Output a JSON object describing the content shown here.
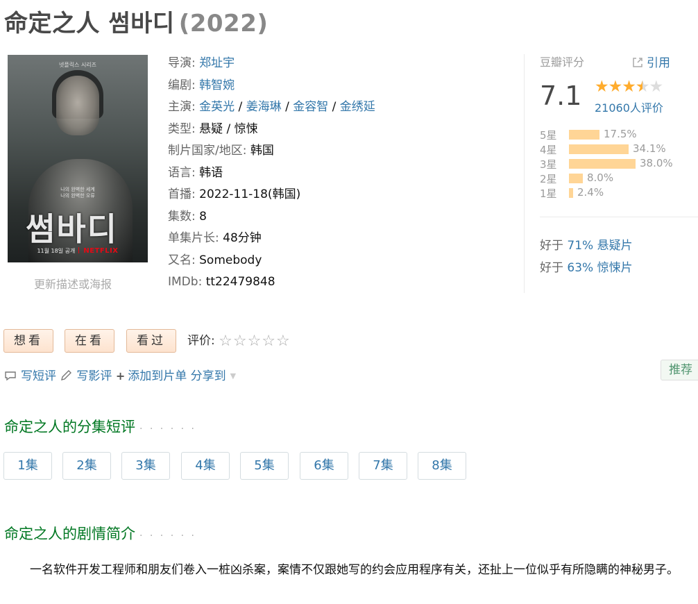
{
  "title": {
    "name": "命定之人 썸바디",
    "year": "(2022)"
  },
  "poster": {
    "topline": "넷플릭스 시리즈",
    "tagline_1": "나의 완벽한 세계",
    "tagline_2": "나의 완벽한 오류",
    "hangul": "썸바디",
    "release_line": "11월 18일 공개",
    "brand": "NETFLIX"
  },
  "update_link": "更新描述或海报",
  "info": {
    "director": {
      "label": "导演: ",
      "names": [
        "郑址宇"
      ]
    },
    "writer": {
      "label": "编剧: ",
      "names": [
        "韩智婉"
      ]
    },
    "cast": {
      "label": "主演: ",
      "names": [
        "金英光",
        "姜海琳",
        "金容智",
        "金绣延"
      ],
      "sep": " / "
    },
    "genre": {
      "label": "类型: ",
      "value": "悬疑 / 惊悚"
    },
    "country": {
      "label": "制片国家/地区: ",
      "value": "韩国"
    },
    "language": {
      "label": "语言: ",
      "value": "韩语"
    },
    "premiere": {
      "label": "首播: ",
      "value": "2022-11-18(韩国)"
    },
    "episodes": {
      "label": "集数: ",
      "value": "8"
    },
    "runtime": {
      "label": "单集片长: ",
      "value": "48分钟"
    },
    "aka": {
      "label": "又名: ",
      "value": "Somebody"
    },
    "imdb": {
      "label": "IMDb: ",
      "value": "tt22479848"
    }
  },
  "rating": {
    "header": "豆瓣评分",
    "cite": "引用",
    "score": "7.1",
    "stars_value": 3.5,
    "votes": "21060人评价",
    "distribution": [
      {
        "label": "5星",
        "percent": "17.5%",
        "value": 17.5
      },
      {
        "label": "4星",
        "percent": "34.1%",
        "value": 34.1
      },
      {
        "label": "3星",
        "percent": "38.0%",
        "value": 38.0
      },
      {
        "label": "2星",
        "percent": "8.0%",
        "value": 8.0
      },
      {
        "label": "1星",
        "percent": "2.4%",
        "value": 2.4
      }
    ],
    "better_than": [
      {
        "prefix": "好于 ",
        "pct": "71%",
        "genre": "悬疑片"
      },
      {
        "prefix": "好于 ",
        "pct": "63%",
        "genre": "惊悚片"
      }
    ]
  },
  "buttons": {
    "want": "想看",
    "watching": "在看",
    "watched": "看过"
  },
  "my_rating": {
    "label": "评价: ",
    "stars": "☆☆☆☆☆"
  },
  "actions": {
    "short_review": "写短评",
    "review": "写影评",
    "add_list": "添加到片单",
    "share": "分享到"
  },
  "recommend": "推荐",
  "episode_section": {
    "title": "命定之人的分集短评",
    "dots": "· · · · · ·",
    "episodes": [
      "1集",
      "2集",
      "3集",
      "4集",
      "5集",
      "6集",
      "7集",
      "8集"
    ]
  },
  "synopsis_section": {
    "title": "命定之人的剧情简介",
    "dots": "· · · · · ·",
    "text": "一名软件开发工程师和朋友们卷入一桩凶杀案，案情不仅跟她写的约会应用程序有关，还扯上一位似乎有所隐瞒的神秘男子。"
  },
  "colors": {
    "link": "#3377aa",
    "section_title": "#007722",
    "star": "#ffac2d",
    "bar": "#ffd596",
    "button_bg": "#fde3cf"
  },
  "icons": {
    "comment": "speech-bubble-icon",
    "edit": "pencil-icon",
    "add": "plus-icon",
    "share_caret": "caret-down-icon",
    "cite": "external-link-icon"
  }
}
